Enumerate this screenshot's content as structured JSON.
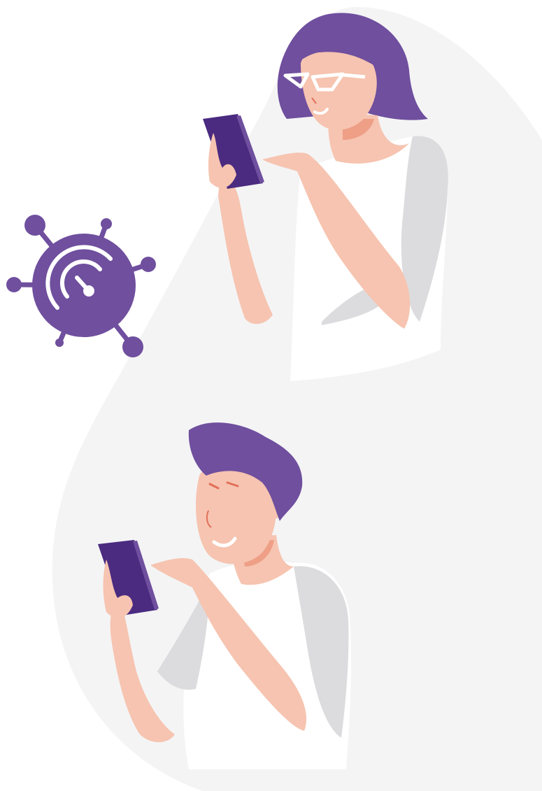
{
  "colors": {
    "background": "#ffffff",
    "blob": "#f4f4f5",
    "brand_purple": "#6f4f9e",
    "phone": "#4a2b80",
    "skin": "#f6c4b0",
    "skin_shadow": "#ee9f86",
    "shirt": "#ffffff",
    "sleeve_grey": "#dcdcde",
    "mouth_accent": "#e2705a"
  },
  "icons": {
    "virus_gauge": "virus-speed-gauge-icon"
  },
  "figures": {
    "top": "woman-with-glasses-using-phone",
    "bottom": "man-smiling-using-phone"
  }
}
